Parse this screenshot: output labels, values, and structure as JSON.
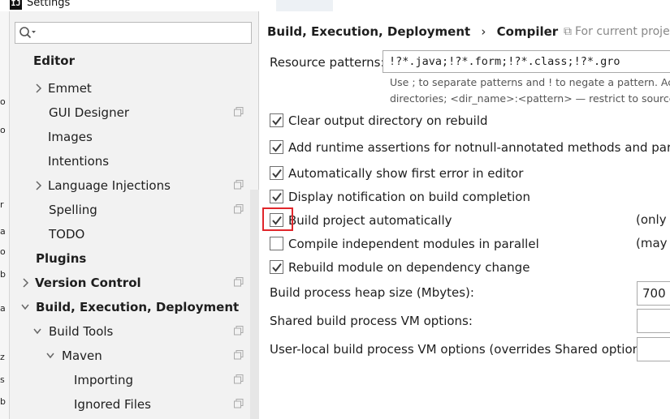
{
  "window": {
    "title": "Settings",
    "app_icon": "intellij-icon"
  },
  "left_edge_chars": [
    "o",
    "o",
    "r",
    "a",
    "o",
    "b",
    "a",
    "z",
    "s",
    "b"
  ],
  "search": {
    "placeholder": "",
    "icon": "search-icon"
  },
  "tree": [
    {
      "label": "Editor",
      "bold": true,
      "arrow": "none",
      "copy": false
    },
    {
      "label": "Emmet",
      "bold": false,
      "arrow": "right",
      "copy": false
    },
    {
      "label": "GUI Designer",
      "bold": false,
      "arrow": "none",
      "copy": true
    },
    {
      "label": "Images",
      "bold": false,
      "arrow": "none",
      "copy": false
    },
    {
      "label": "Intentions",
      "bold": false,
      "arrow": "none",
      "copy": false
    },
    {
      "label": "Language Injections",
      "bold": false,
      "arrow": "right",
      "copy": true
    },
    {
      "label": "Spelling",
      "bold": false,
      "arrow": "none",
      "copy": true
    },
    {
      "label": "TODO",
      "bold": false,
      "arrow": "none",
      "copy": false
    },
    {
      "label": "Plugins",
      "bold": true,
      "arrow": "none",
      "copy": false
    },
    {
      "label": "Version Control",
      "bold": true,
      "arrow": "right",
      "copy": true
    },
    {
      "label": "Build, Execution, Deployment",
      "bold": true,
      "arrow": "down",
      "copy": false
    },
    {
      "label": "Build Tools",
      "bold": false,
      "arrow": "down",
      "copy": true
    },
    {
      "label": "Maven",
      "bold": false,
      "arrow": "down",
      "copy": true
    },
    {
      "label": "Importing",
      "bold": false,
      "arrow": "none",
      "copy": true
    },
    {
      "label": "Ignored Files",
      "bold": false,
      "arrow": "none",
      "copy": true
    }
  ],
  "content": {
    "breadcrumb_parent": "Build, Execution, Deployment",
    "breadcrumb_sep": "›",
    "breadcrumb_current": "Compiler",
    "scope_note": "For current proje",
    "resource_patterns_label": "Resource patterns:",
    "resource_patterns_value": "!?*.java;!?*.form;!?*.class;!?*.gro",
    "hint_line1": "Use ; to separate patterns and ! to negate a pattern. Acc",
    "hint_line2": "directories; <dir_name>:<pattern> — restrict to source",
    "checkboxes": [
      {
        "label": "Clear output directory on rebuild",
        "checked": true,
        "note": ""
      },
      {
        "label": "Add runtime assertions for notnull-annotated methods and paramet",
        "checked": true,
        "note": ""
      },
      {
        "label": "Automatically show first error in editor",
        "checked": true,
        "note": ""
      },
      {
        "label": "Display notification on build completion",
        "checked": true,
        "note": ""
      },
      {
        "label": "Build project automatically",
        "checked": true,
        "note": "(only v"
      },
      {
        "label": "Compile independent modules in parallel",
        "checked": false,
        "note": "(may r"
      },
      {
        "label": "Rebuild module on dependency change",
        "checked": true,
        "note": ""
      }
    ],
    "heap_label": "Build process heap size (Mbytes):",
    "heap_value": "700",
    "shared_vm_label": "Shared build process VM options:",
    "shared_vm_value": "",
    "user_vm_label": "User-local build process VM options (overrides Shared options):",
    "user_vm_value": ""
  },
  "colors": {
    "highlight_box": "#e0262b",
    "check": "#3c3c3c",
    "sidebar_bg": "#f2f2f2"
  }
}
